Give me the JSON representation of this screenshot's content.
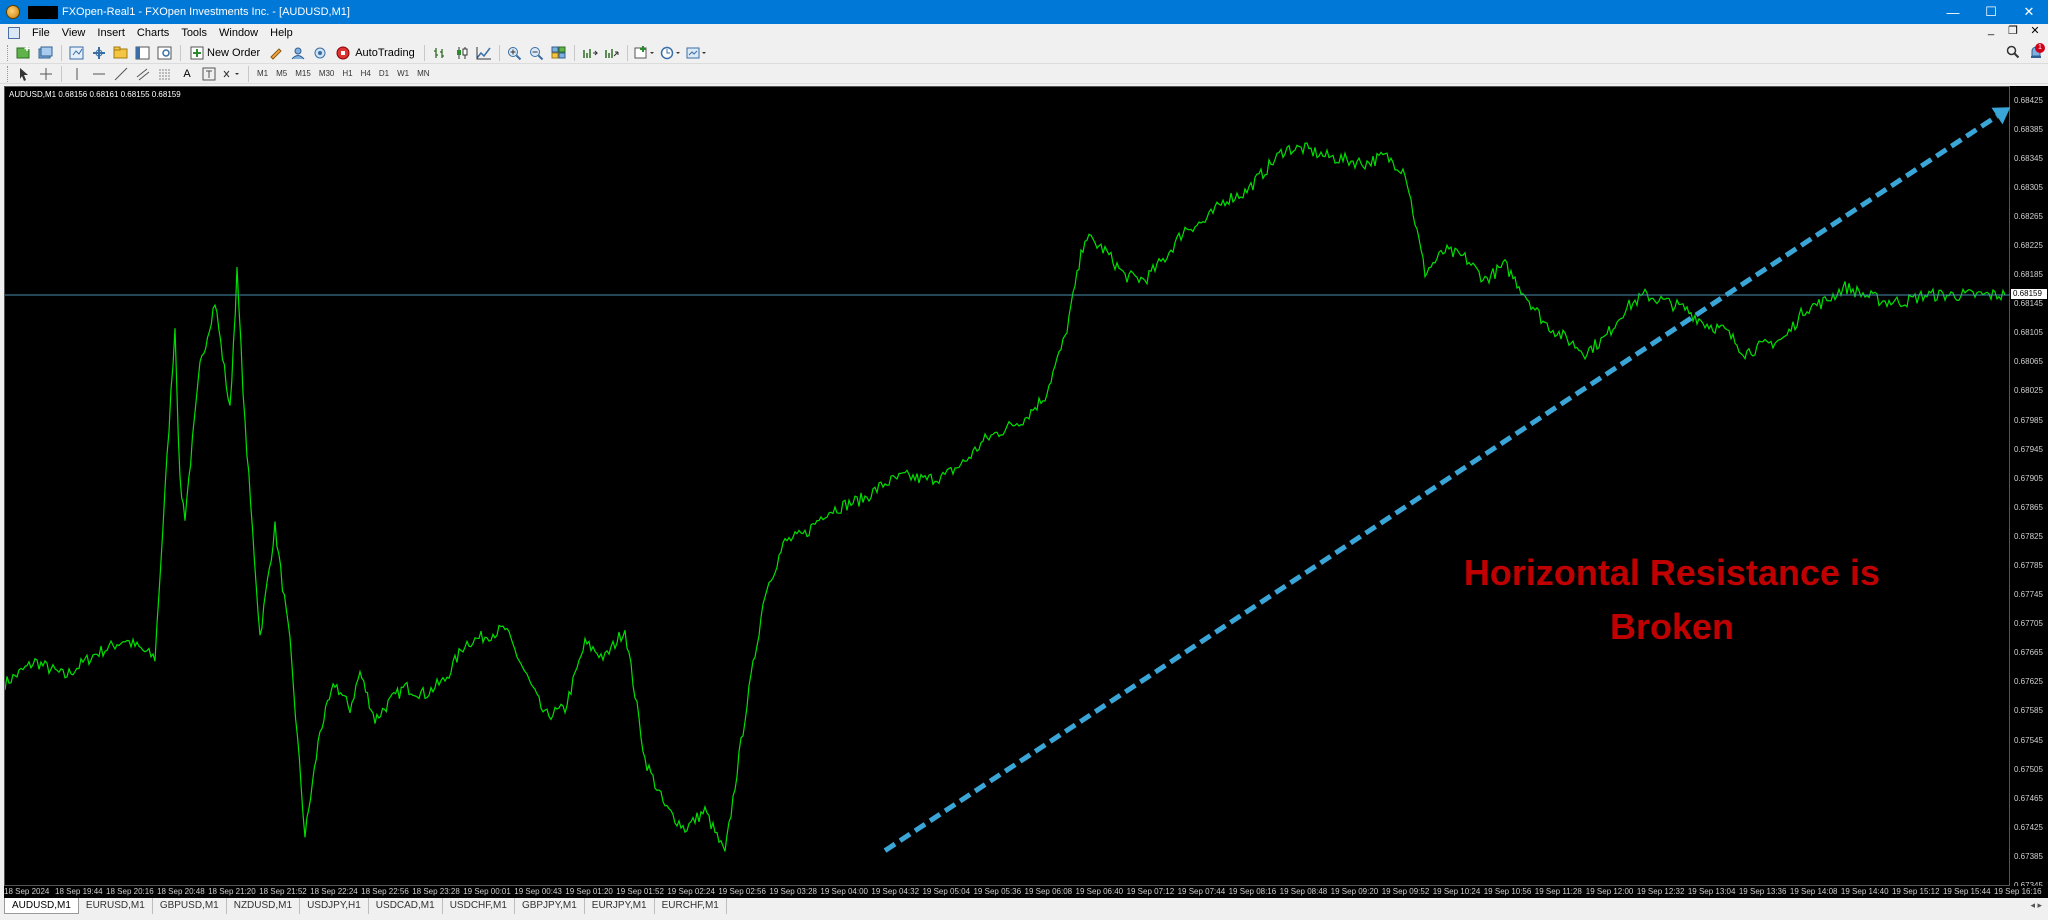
{
  "window": {
    "title": "FXOpen-Real1 - FXOpen Investments Inc. - [AUDUSD,M1]",
    "minimize": "—",
    "maximize": "☐",
    "close": "✕"
  },
  "menu": {
    "items": [
      "File",
      "View",
      "Insert",
      "Charts",
      "Tools",
      "Window",
      "Help"
    ],
    "doc_controls": [
      "_",
      "❐",
      "✕"
    ]
  },
  "toolbar": {
    "new_order": "New Order",
    "autotrading": "AutoTrading",
    "draw_text": "A",
    "notifications_count": "1"
  },
  "timeframes": [
    "M1",
    "M5",
    "M15",
    "M30",
    "H1",
    "H4",
    "D1",
    "W1",
    "MN"
  ],
  "chart": {
    "symbol_info": "AUDUSD,M1  0.68156 0.68161 0.68155 0.68159",
    "current_price": "0.68159",
    "annotation_line1": "Horizontal Resistance is",
    "annotation_line2": "Broken",
    "price_labels": [
      "0.68425",
      "0.68385",
      "0.68345",
      "0.68305",
      "0.68265",
      "0.68225",
      "0.68185",
      "0.68145",
      "0.68105",
      "0.68065",
      "0.68025",
      "0.67985",
      "0.67945",
      "0.67905",
      "0.67865",
      "0.67825",
      "0.67785",
      "0.67745",
      "0.67705",
      "0.67665",
      "0.67625",
      "0.67585",
      "0.67545",
      "0.67505",
      "0.67465",
      "0.67425",
      "0.67385",
      "0.67345"
    ],
    "time_labels": [
      "18 Sep 2024",
      "18 Sep 19:44",
      "18 Sep 20:16",
      "18 Sep 20:48",
      "18 Sep 21:20",
      "18 Sep 21:52",
      "18 Sep 22:24",
      "18 Sep 22:56",
      "18 Sep 23:28",
      "19 Sep 00:01",
      "19 Sep 00:43",
      "19 Sep 01:20",
      "19 Sep 01:52",
      "19 Sep 02:24",
      "19 Sep 02:56",
      "19 Sep 03:28",
      "19 Sep 04:00",
      "19 Sep 04:32",
      "19 Sep 05:04",
      "19 Sep 05:36",
      "19 Sep 06:08",
      "19 Sep 06:40",
      "19 Sep 07:12",
      "19 Sep 07:44",
      "19 Sep 08:16",
      "19 Sep 08:48",
      "19 Sep 09:20",
      "19 Sep 09:52",
      "19 Sep 10:24",
      "19 Sep 10:56",
      "19 Sep 11:28",
      "19 Sep 12:00",
      "19 Sep 12:32",
      "19 Sep 13:04",
      "19 Sep 13:36",
      "19 Sep 14:08",
      "19 Sep 14:40",
      "19 Sep 15:12",
      "19 Sep 15:44",
      "19 Sep 16:16"
    ],
    "line_color": "#00e000",
    "trendline_color": "#3aa6d8",
    "hline_color": "#4a90b0",
    "annotation_color": "#c00000"
  },
  "chart_data": {
    "type": "line",
    "ylim": [
      0.67345,
      0.68445
    ],
    "series": [
      {
        "name": "AUDUSD,M1",
        "x_index": [
          0,
          30,
          60,
          90,
          120,
          150,
          170,
          175,
          180,
          195,
          210,
          225,
          232,
          240,
          255,
          270,
          285,
          300,
          315,
          330,
          345,
          355,
          370,
          385,
          400,
          420,
          440,
          460,
          480,
          500,
          520,
          540,
          560,
          580,
          600,
          620,
          640,
          660,
          680,
          700,
          720,
          740,
          760,
          780,
          800,
          820,
          840,
          860,
          880,
          900,
          920,
          940,
          960,
          980,
          1000,
          1020,
          1040,
          1060,
          1080,
          1100,
          1120,
          1140,
          1160,
          1180,
          1200,
          1220,
          1240,
          1260,
          1280,
          1300,
          1320,
          1340,
          1360,
          1380,
          1400,
          1420,
          1440,
          1460,
          1480,
          1500,
          1520,
          1540,
          1560,
          1580,
          1600,
          1620,
          1640,
          1660,
          1680,
          1700,
          1720,
          1740,
          1760,
          1780,
          1800,
          1820,
          1840,
          1860,
          1880,
          1900,
          1920,
          1940,
          1960,
          1980,
          2000
        ],
        "y": [
          0.67625,
          0.67655,
          0.67635,
          0.67665,
          0.67685,
          0.6766,
          0.68115,
          0.679,
          0.67855,
          0.6806,
          0.6815,
          0.68,
          0.6819,
          0.6798,
          0.6769,
          0.6784,
          0.6768,
          0.67415,
          0.6756,
          0.67625,
          0.6759,
          0.6764,
          0.67575,
          0.676,
          0.6762,
          0.6761,
          0.6763,
          0.6768,
          0.6769,
          0.677,
          0.6764,
          0.6758,
          0.6759,
          0.6768,
          0.6766,
          0.677,
          0.6752,
          0.67455,
          0.67425,
          0.6745,
          0.6739,
          0.6758,
          0.6775,
          0.6782,
          0.6783,
          0.6786,
          0.6787,
          0.6788,
          0.679,
          0.6791,
          0.67905,
          0.6791,
          0.6793,
          0.6796,
          0.67975,
          0.6799,
          0.6802,
          0.681,
          0.6824,
          0.6822,
          0.68185,
          0.6818,
          0.6821,
          0.6825,
          0.6826,
          0.6829,
          0.683,
          0.6833,
          0.6836,
          0.6836,
          0.6835,
          0.68345,
          0.6834,
          0.6835,
          0.6833,
          0.6819,
          0.6822,
          0.6821,
          0.6818,
          0.682,
          0.6816,
          0.6812,
          0.681,
          0.6808,
          0.681,
          0.6814,
          0.68159,
          0.6815,
          0.6814,
          0.6812,
          0.6811,
          0.6808,
          0.6809,
          0.681,
          0.6814,
          0.6815,
          0.6817,
          0.68159,
          0.6815,
          0.6815,
          0.68159,
          0.68159,
          0.68159,
          0.68159,
          0.68159
        ]
      }
    ],
    "horizontal_line": 0.68159,
    "trendline": {
      "from": {
        "x_index": 880,
        "y": 0.67395
      },
      "to": {
        "x_index": 2006,
        "y": 0.68405
      }
    }
  },
  "tabs": [
    "AUDUSD,M1",
    "EURUSD,M1",
    "GBPUSD,M1",
    "NZDUSD,M1",
    "USDJPY,H1",
    "USDCAD,M1",
    "USDCHF,M1",
    "GBPJPY,M1",
    "EURJPY,M1",
    "EURCHF,M1"
  ],
  "tab_scroll": "◂ ▸"
}
